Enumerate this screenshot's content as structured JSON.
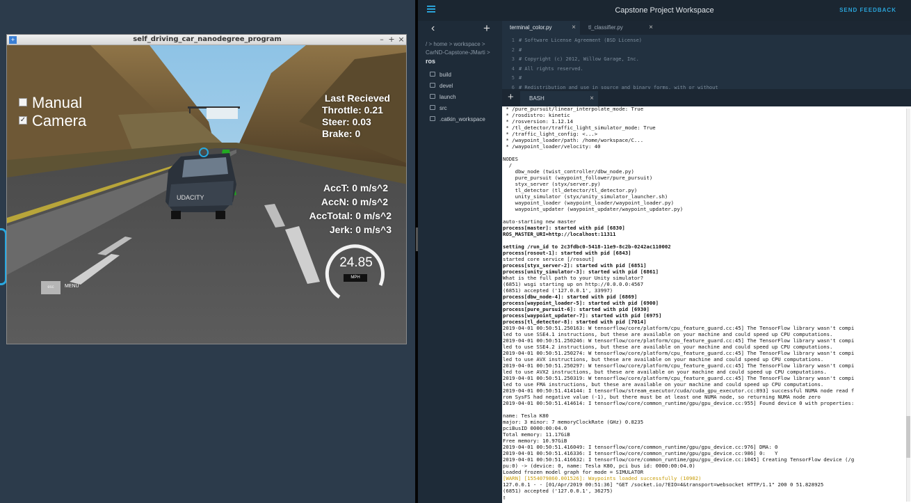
{
  "simulator": {
    "window_title": "self_driving_car_nanodegree_program",
    "manual_label": "Manual",
    "camera_label": "Camera",
    "camera_checked": true,
    "manual_checked": false,
    "telemetry": {
      "last_received": "Last Recieved",
      "throttle": "Throttle: 0.21",
      "steer": "Steer: 0.03",
      "brake": "Brake: 0"
    },
    "accel": {
      "acct": "AccT: 0 m/s^2",
      "accn": "AccN: 0 m/s^2",
      "acctotal": "AccTotal: 0 m/s^2",
      "jerk": "Jerk: 0 m/s^3"
    },
    "speed": "24.85",
    "speed_unit": "MPH",
    "speed_fraction": 0.5,
    "esc_key": "esc",
    "menu_label": "MENU",
    "car_brand": "UDACITY"
  },
  "workspace": {
    "title": "Capstone Project Workspace",
    "send_feedback": "SEND FEEDBACK",
    "breadcrumb": [
      "/ > home > workspace >",
      "CarND-Capstone-JMarti >"
    ],
    "breadcrumb_current": "ros",
    "files": [
      "build",
      "devel",
      "launch",
      "src",
      ".catkin_workspace"
    ],
    "editor_tabs": [
      "terminal_color.py",
      "tl_classifier.py"
    ],
    "code": [
      {
        "n": "1",
        "t": "# Software License Agreement (BSD License)"
      },
      {
        "n": "2",
        "t": "#"
      },
      {
        "n": "3",
        "t": "# Copyright (c) 2012, Willow Garage, Inc."
      },
      {
        "n": "4",
        "t": "# All rights reserved."
      },
      {
        "n": "5",
        "t": "#"
      },
      {
        "n": "6",
        "t": "# Redistribution and use in source and binary forms, with or without"
      }
    ],
    "terminal_tab": "BASH",
    "terminal_lines": [
      {
        "t": " * /pure_pursuit/linear_interpolate_mode: True",
        "s": "n"
      },
      {
        "t": " * /rosdistro: kinetic",
        "s": "n"
      },
      {
        "t": " * /rosversion: 1.12.14",
        "s": "n"
      },
      {
        "t": " * /tl_detector/traffic_light_simulator_mode: True",
        "s": "n"
      },
      {
        "t": " * /traffic_light_config: <...>",
        "s": "n"
      },
      {
        "t": " * /waypoint_loader/path: /home/workspace/C...",
        "s": "n"
      },
      {
        "t": " * /waypoint_loader/velocity: 40",
        "s": "n"
      },
      {
        "t": "",
        "s": "n"
      },
      {
        "t": "NODES",
        "s": "n"
      },
      {
        "t": "  /",
        "s": "n"
      },
      {
        "t": "    dbw_node (twist_controller/dbw_node.py)",
        "s": "n"
      },
      {
        "t": "    pure_pursuit (waypoint_follower/pure_pursuit)",
        "s": "n"
      },
      {
        "t": "    styx_server (styx/server.py)",
        "s": "n"
      },
      {
        "t": "    tl_detector (tl_detector/tl_detector.py)",
        "s": "n"
      },
      {
        "t": "    unity_simulator (styx/unity_simulator_launcher.sh)",
        "s": "n"
      },
      {
        "t": "    waypoint_loader (waypoint_loader/waypoint_loader.py)",
        "s": "n"
      },
      {
        "t": "    waypoint_updater (waypoint_updater/waypoint_updater.py)",
        "s": "n"
      },
      {
        "t": "",
        "s": "n"
      },
      {
        "t": "auto-starting new master",
        "s": "n"
      },
      {
        "t": "process[master]: started with pid [6830]",
        "s": "b"
      },
      {
        "t": "ROS_MASTER_URI=http://localhost:11311",
        "s": "b"
      },
      {
        "t": "",
        "s": "n"
      },
      {
        "t": "setting /run_id to 2c3fdbc0-5418-11e9-8c2b-0242ac110002",
        "s": "b"
      },
      {
        "t": "process[rosout-1]: started with pid [6843]",
        "s": "b"
      },
      {
        "t": "started core service [/rosout]",
        "s": "n"
      },
      {
        "t": "process[styx_server-2]: started with pid [6851]",
        "s": "b"
      },
      {
        "t": "process[unity_simulator-3]: started with pid [6861]",
        "s": "b"
      },
      {
        "t": "What is the full path to your Unity simulator?",
        "s": "n"
      },
      {
        "t": "(6851) wsgi starting up on http://0.0.0.0:4567",
        "s": "n"
      },
      {
        "t": "(6851) accepted ('127.0.0.1', 33997)",
        "s": "n"
      },
      {
        "t": "process[dbw_node-4]: started with pid [6869]",
        "s": "b"
      },
      {
        "t": "process[waypoint_loader-5]: started with pid [6900]",
        "s": "b"
      },
      {
        "t": "process[pure_pursuit-6]: started with pid [6930]",
        "s": "b"
      },
      {
        "t": "process[waypoint_updater-7]: started with pid [6975]",
        "s": "b"
      },
      {
        "t": "process[tl_detector-8]: started with pid [7014]",
        "s": "b"
      },
      {
        "t": "2019-04-01 00:50:51.250163: W tensorflow/core/platform/cpu_feature_guard.cc:45] The TensorFlow library wasn't compi",
        "s": "n"
      },
      {
        "t": "led to use SSE4.1 instructions, but these are available on your machine and could speed up CPU computations.",
        "s": "n"
      },
      {
        "t": "2019-04-01 00:50:51.250246: W tensorflow/core/platform/cpu_feature_guard.cc:45] The TensorFlow library wasn't compi",
        "s": "n"
      },
      {
        "t": "led to use SSE4.2 instructions, but these are available on your machine and could speed up CPU computations.",
        "s": "n"
      },
      {
        "t": "2019-04-01 00:50:51.250274: W tensorflow/core/platform/cpu_feature_guard.cc:45] The TensorFlow library wasn't compi",
        "s": "n"
      },
      {
        "t": "led to use AVX instructions, but these are available on your machine and could speed up CPU computations.",
        "s": "n"
      },
      {
        "t": "2019-04-01 00:50:51.250297: W tensorflow/core/platform/cpu_feature_guard.cc:45] The TensorFlow library wasn't compi",
        "s": "n"
      },
      {
        "t": "led to use AVX2 instructions, but these are available on your machine and could speed up CPU computations.",
        "s": "n"
      },
      {
        "t": "2019-04-01 00:50:51.250319: W tensorflow/core/platform/cpu_feature_guard.cc:45] The TensorFlow library wasn't compi",
        "s": "n"
      },
      {
        "t": "led to use FMA instructions, but these are available on your machine and could speed up CPU computations.",
        "s": "n"
      },
      {
        "t": "2019-04-01 00:50:51.414144: I tensorflow/stream_executor/cuda/cuda_gpu_executor.cc:893] successful NUMA node read f",
        "s": "n"
      },
      {
        "t": "rom SysFS had negative value (-1), but there must be at least one NUMA node, so returning NUMA node zero",
        "s": "n"
      },
      {
        "t": "2019-04-01 00:50:51.414614: I tensorflow/core/common_runtime/gpu/gpu_device.cc:955] Found device 0 with properties:",
        "s": "n"
      },
      {
        "t": "",
        "s": "n"
      },
      {
        "t": "name: Tesla K80",
        "s": "n"
      },
      {
        "t": "major: 3 minor: 7 memoryClockRate (GHz) 0.8235",
        "s": "n"
      },
      {
        "t": "pciBusID 0000:00:04.0",
        "s": "n"
      },
      {
        "t": "Total memory: 11.17GiB",
        "s": "n"
      },
      {
        "t": "Free memory: 10.97GiB",
        "s": "n"
      },
      {
        "t": "2019-04-01 00:50:51.416049: I tensorflow/core/common_runtime/gpu/gpu_device.cc:976] DMA: 0",
        "s": "n"
      },
      {
        "t": "2019-04-01 00:50:51.416336: I tensorflow/core/common_runtime/gpu/gpu_device.cc:986] 0:   Y",
        "s": "n"
      },
      {
        "t": "2019-04-01 00:50:51.416632: I tensorflow/core/common_runtime/gpu/gpu_device.cc:1045] Creating TensorFlow device (/g",
        "s": "n"
      },
      {
        "t": "pu:0) -> (device: 0, name: Tesla K80, pci bus id: 0000:00:04.0)",
        "s": "n"
      },
      {
        "t": "Loaded frozen model graph for mode = SIMULATOR",
        "s": "n"
      },
      {
        "t": "[WARN] [1554079860.001526]: Waypoints loaded successfully (10902)",
        "s": "w"
      },
      {
        "t": "127.0.0.1 - - [01/Apr/2019 00:51:36] \"GET /socket.io/?EIO=4&transport=websocket HTTP/1.1\" 200 0 51.828925",
        "s": "n"
      },
      {
        "t": "(6851) accepted ('127.0.0.1', 36275)",
        "s": "n"
      },
      {
        "t": "▯",
        "s": "n"
      }
    ]
  }
}
